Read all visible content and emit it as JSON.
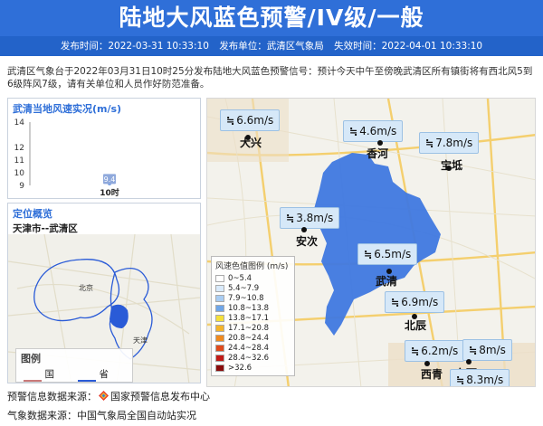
{
  "header": {
    "title": "陆地大风蓝色预警/IV级/一般",
    "publish_time": "发布时间：2022-03-31 10:33:10",
    "publisher": "发布单位：武清区气象局",
    "expire_time": "失效时间：2022-04-01 10:33:10"
  },
  "description": "武清区气象台于2022年03月31日10时25分发布陆地大风蓝色预警信号：预计今天中午至傍晚武清区所有镇街将有西北风5到6级阵风7级，请有关单位和人员作好防范准备。",
  "wind_panel": {
    "title": "武清当地风速实况(m/s)"
  },
  "chart_data": {
    "type": "scatter",
    "title": "武清当地风速实况(m/s)",
    "categories": [
      "10时"
    ],
    "values": [
      9.4
    ],
    "ylim": [
      9,
      14
    ],
    "yticks": [
      14,
      12,
      11,
      10,
      9
    ],
    "data_labels": [
      "9.4"
    ]
  },
  "location_panel": {
    "title": "定位概览",
    "subtitle": "天津市--武清区",
    "map_labels": [
      "北京",
      "天津"
    ],
    "legend": {
      "title": "图例",
      "items": [
        {
          "label": "国界",
          "color": "#c97a7a"
        },
        {
          "label": "省界",
          "color": "#2a5bd7"
        }
      ]
    }
  },
  "map": {
    "stations": [
      {
        "wind": "6.6m/s",
        "city": "大兴"
      },
      {
        "wind": "4.6m/s",
        "city": "香河"
      },
      {
        "wind": "7.8m/s",
        "city": "宝坻"
      },
      {
        "wind": "3.8m/s",
        "city": "安次"
      },
      {
        "wind": "6.5m/s",
        "city": "武清"
      },
      {
        "wind": "6.9m/s",
        "city": "北辰"
      },
      {
        "wind": "6.2m/s",
        "city": "西青"
      },
      {
        "wind": "8m/s",
        "city": "东丽"
      },
      {
        "wind": "8.3m/s",
        "city": ""
      }
    ],
    "wind_icon": "wind-icon",
    "scale": {
      "title": "风速色值图例 (m/s)",
      "items": [
        {
          "label": "0~5.4",
          "color": "#ffffff"
        },
        {
          "label": "5.4~7.9",
          "color": "#d9eafb"
        },
        {
          "label": "7.9~10.8",
          "color": "#a9cdf3"
        },
        {
          "label": "10.8~13.8",
          "color": "#6fa6e8"
        },
        {
          "label": "13.8~17.1",
          "color": "#f5e03a"
        },
        {
          "label": "17.1~20.8",
          "color": "#f5b52a"
        },
        {
          "label": "20.8~24.4",
          "color": "#f08a1e"
        },
        {
          "label": "24.4~28.4",
          "color": "#e04b1c"
        },
        {
          "label": "28.4~32.6",
          "color": "#c21b17"
        },
        {
          "label": ">32.6",
          "color": "#8a0c0c"
        }
      ]
    },
    "region_color": "#3f78e0"
  },
  "footer": {
    "source_label": "预警信息数据来源：",
    "source_value": "国家预警信息发布中心",
    "weather_source": "气象数据来源：中国气象局全国自动站实况"
  }
}
